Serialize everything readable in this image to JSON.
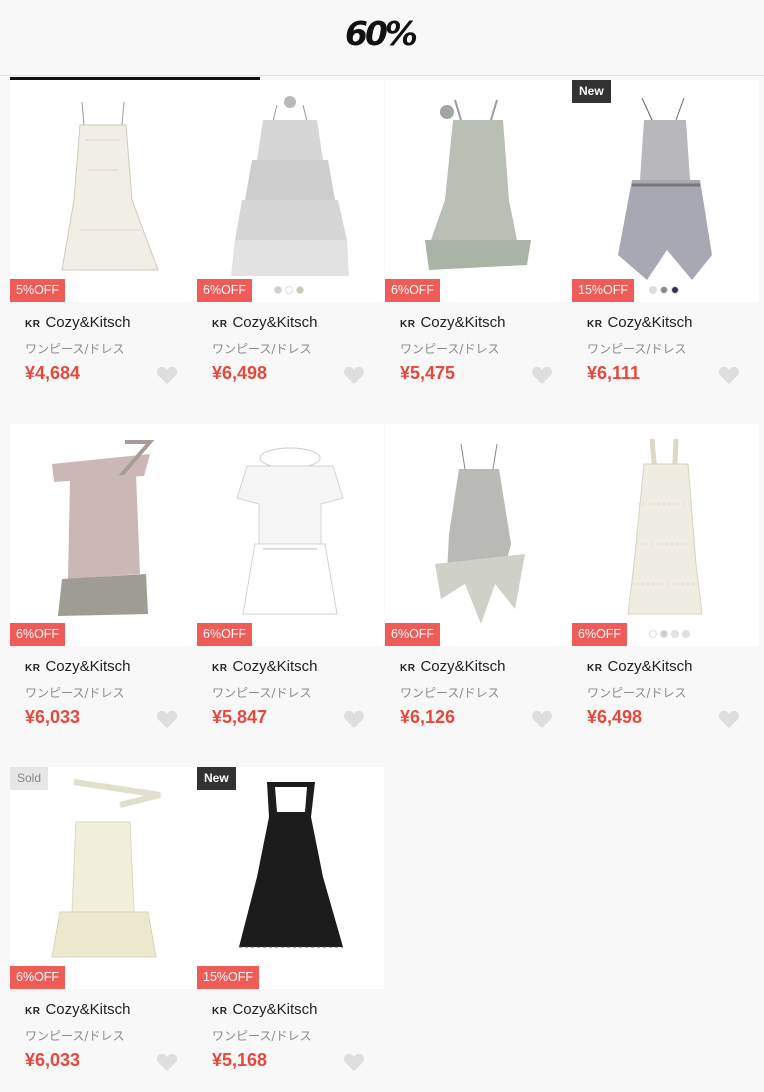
{
  "header": {
    "logo": "60%"
  },
  "products": [
    {
      "discount": "5%OFF",
      "brand_country": "KR",
      "brand": "Cozy&Kitsch",
      "category": "ワンピース/ドレス",
      "price": "¥4,684",
      "top_badge": "",
      "swatches": [],
      "dress_color": "#f1eee5",
      "style": "slip"
    },
    {
      "discount": "6%OFF",
      "brand_country": "KR",
      "brand": "Cozy&Kitsch",
      "category": "ワンピース/ドレス",
      "price": "¥6,498",
      "top_badge": "",
      "swatches": [
        "#cfcfcf",
        "#ffffff",
        "#c9c8b4"
      ],
      "dress_color": "#d6d6d6",
      "style": "ruffle"
    },
    {
      "discount": "6%OFF",
      "brand_country": "KR",
      "brand": "Cozy&Kitsch",
      "category": "ワンピース/ドレス",
      "price": "¥5,475",
      "top_badge": "",
      "swatches": [],
      "dress_color": "#b9bfb4",
      "style": "tank"
    },
    {
      "discount": "15%OFF",
      "brand_country": "KR",
      "brand": "Cozy&Kitsch",
      "category": "ワンピース/ドレス",
      "price": "¥6,111",
      "top_badge": "New",
      "swatches": [
        "#dddddd",
        "#8a8a8a",
        "#2d3150"
      ],
      "dress_color": "#b8b8bc",
      "style": "layered"
    },
    {
      "discount": "6%OFF",
      "brand_country": "KR",
      "brand": "Cozy&Kitsch",
      "category": "ワンピース/ドレス",
      "price": "¥6,033",
      "top_badge": "",
      "swatches": [],
      "dress_color": "#c9b8b5",
      "style": "offshoulder"
    },
    {
      "discount": "6%OFF",
      "brand_country": "KR",
      "brand": "Cozy&Kitsch",
      "category": "ワンピース/ドレス",
      "price": "¥5,847",
      "top_badge": "",
      "swatches": [],
      "dress_color": "#f5f5f5",
      "style": "blouse"
    },
    {
      "discount": "6%OFF",
      "brand_country": "KR",
      "brand": "Cozy&Kitsch",
      "category": "ワンピース/ドレス",
      "price": "¥6,126",
      "top_badge": "",
      "swatches": [],
      "dress_color": "#b9b9b6",
      "style": "asym"
    },
    {
      "discount": "6%OFF",
      "brand_country": "KR",
      "brand": "Cozy&Kitsch",
      "category": "ワンピース/ドレス",
      "price": "¥6,498",
      "top_badge": "",
      "swatches": [
        "#ffffff",
        "#c7d1da",
        "#dfe6e6",
        "#e4e2d8"
      ],
      "dress_color": "#efece2",
      "style": "knit"
    },
    {
      "discount": "6%OFF",
      "brand_country": "KR",
      "brand": "Cozy&Kitsch",
      "category": "ワンピース/ドレス",
      "price": "¥6,033",
      "top_badge": "Sold",
      "swatches": [],
      "dress_color": "#f1efdc",
      "style": "bustier"
    },
    {
      "discount": "15%OFF",
      "brand_country": "KR",
      "brand": "Cozy&Kitsch",
      "category": "ワンピース/ドレス",
      "price": "¥5,168",
      "top_badge": "New",
      "swatches": [],
      "dress_color": "#1c1c1c",
      "style": "black"
    }
  ]
}
